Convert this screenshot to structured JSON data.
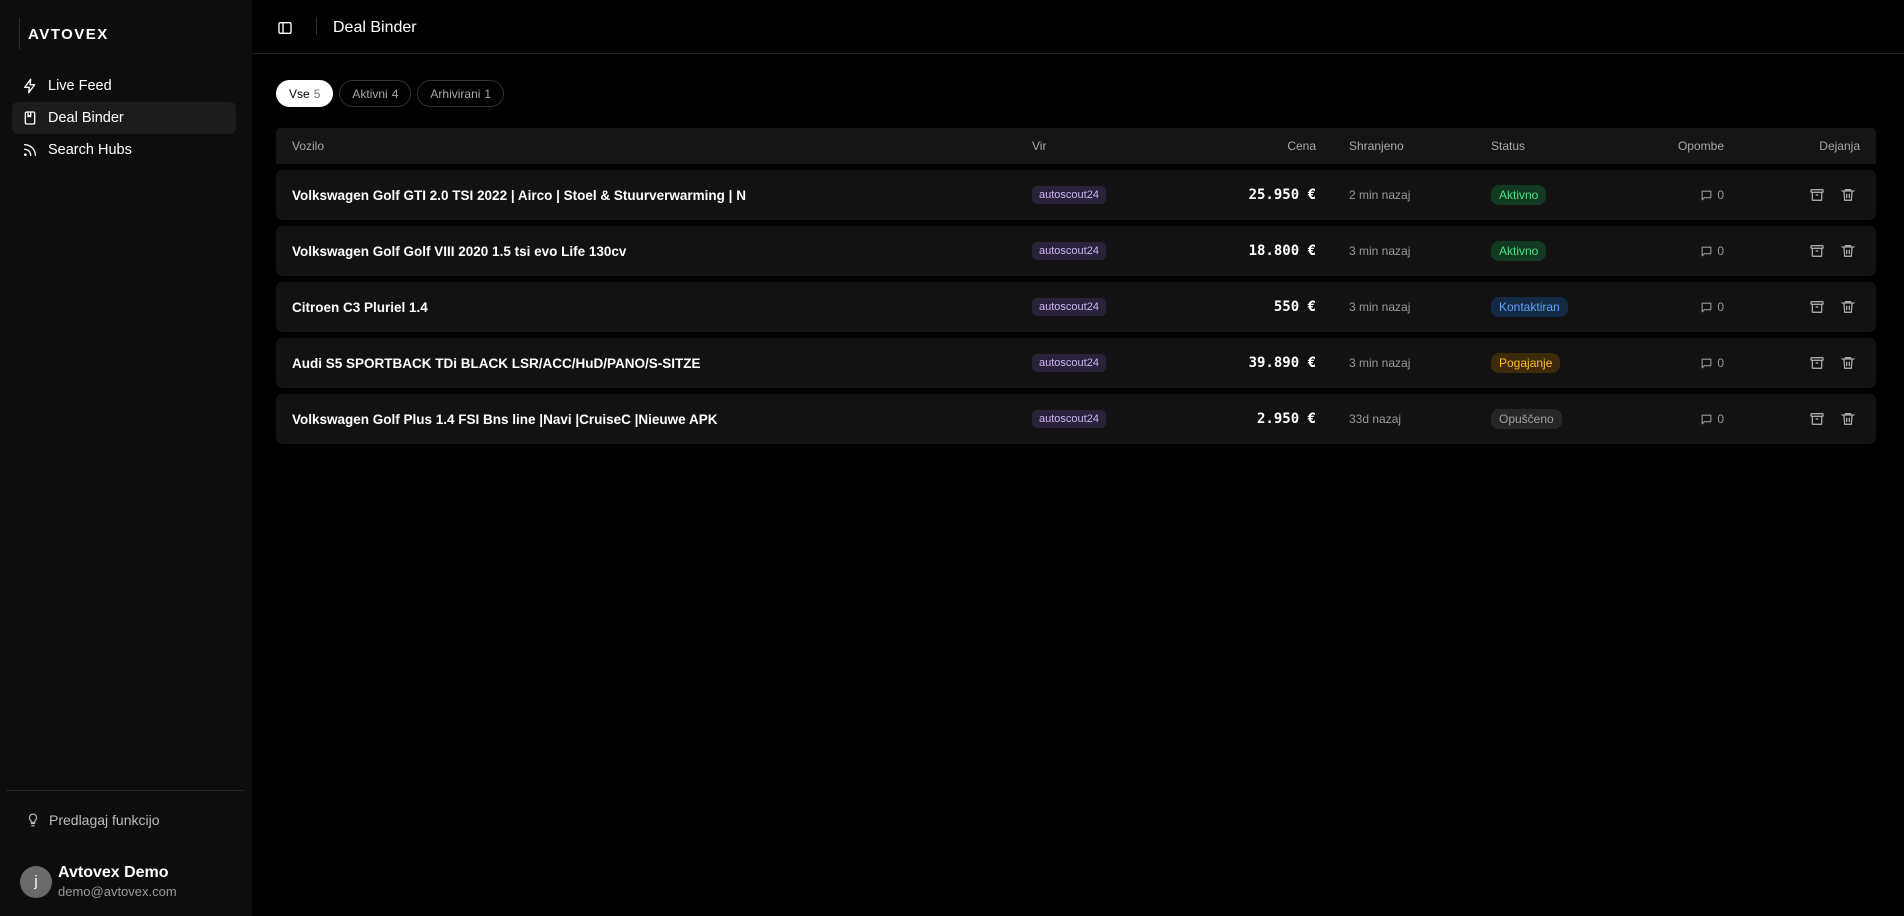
{
  "app": {
    "logo": "AVTOVEX"
  },
  "sidebar": {
    "items": [
      {
        "label": "Live Feed",
        "icon": "lightning-icon"
      },
      {
        "label": "Deal Binder",
        "icon": "book-icon"
      },
      {
        "label": "Search Hubs",
        "icon": "rss-icon"
      }
    ],
    "suggest_label": "Predlagaj funkcijo",
    "user": {
      "initial": "j",
      "name": "Avtovex Demo",
      "email": "demo@avtovex.com"
    }
  },
  "header": {
    "title": "Deal Binder"
  },
  "tabs": [
    {
      "label": "Vse",
      "count": "5"
    },
    {
      "label": "Aktivni",
      "count": "4"
    },
    {
      "label": "Arhivirani",
      "count": "1"
    }
  ],
  "table": {
    "columns": {
      "vehicle": "Vozilo",
      "source": "Vir",
      "price": "Cena",
      "saved": "Shranjeno",
      "status": "Status",
      "notes": "Opombe",
      "actions": "Dejanja"
    },
    "rows": [
      {
        "vehicle": "Volkswagen Golf GTI 2.0 TSI 2022 | Airco | Stoel & Stuurverwarming | N",
        "source": "autoscout24",
        "price": "25.950 €",
        "saved": "2 min nazaj",
        "status": "Aktivno",
        "notes": "0"
      },
      {
        "vehicle": "Volkswagen Golf Golf VIII 2020 1.5 tsi evo Life 130cv",
        "source": "autoscout24",
        "price": "18.800 €",
        "saved": "3 min nazaj",
        "status": "Aktivno",
        "notes": "0"
      },
      {
        "vehicle": "Citroen C3 Pluriel 1.4",
        "source": "autoscout24",
        "price": "550 €",
        "saved": "3 min nazaj",
        "status": "Kontaktiran",
        "notes": "0"
      },
      {
        "vehicle": "Audi S5 SPORTBACK TDi BLACK LSR/ACC/HuD/PANO/S-SITZE",
        "source": "autoscout24",
        "price": "39.890 €",
        "saved": "3 min nazaj",
        "status": "Pogajanje",
        "notes": "0"
      },
      {
        "vehicle": "Volkswagen Golf Plus 1.4 FSI Bns line |Navi |CruiseC |Nieuwe APK",
        "source": "autoscout24",
        "price": "2.950 €",
        "saved": "33d nazaj",
        "status": "Opuščeno",
        "notes": "0"
      }
    ]
  },
  "status_colors": {
    "Aktivno": {
      "bg": "#123a22",
      "fg": "#4ade80"
    },
    "Kontaktiran": {
      "bg": "#132a45",
      "fg": "#60a5fa"
    },
    "Pogajanje": {
      "bg": "#3d2a0a",
      "fg": "#fbbf24"
    },
    "Opuščeno": {
      "bg": "#262626",
      "fg": "#a3a3a3"
    }
  }
}
